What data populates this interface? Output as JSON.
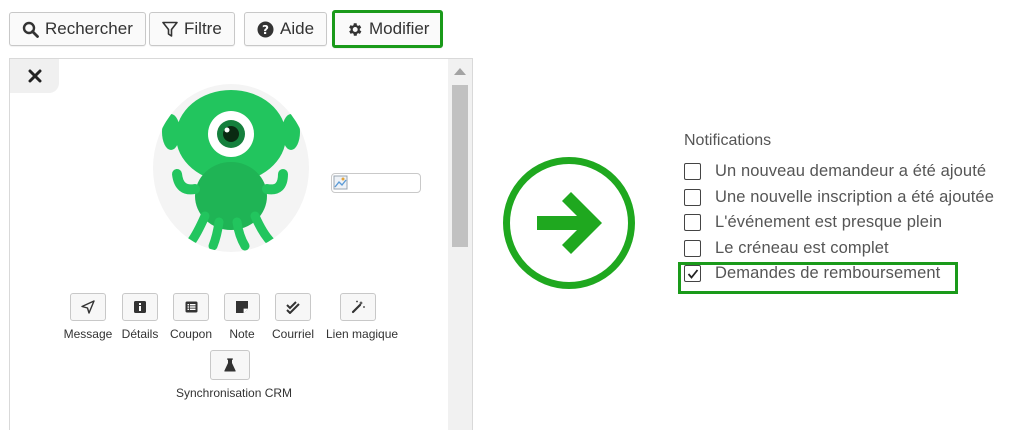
{
  "toolbar": {
    "search_label": "Rechercher",
    "filter_label": "Filtre",
    "help_label": "Aide",
    "edit_label": "Modifier"
  },
  "actions": [
    {
      "label": "Message",
      "icon": "send-icon"
    },
    {
      "label": "Détails",
      "icon": "info-icon"
    },
    {
      "label": "Coupon",
      "icon": "list-icon"
    },
    {
      "label": "Note",
      "icon": "note-icon"
    },
    {
      "label": "Courriel",
      "icon": "double-check-icon"
    },
    {
      "label": "Lien magique",
      "icon": "magic-wand-icon"
    },
    {
      "label": "Synchronisation CRM",
      "icon": "flask-icon"
    }
  ],
  "notifications": {
    "title": "Notifications",
    "items": [
      {
        "label": "Un nouveau demandeur a été ajouté",
        "checked": false
      },
      {
        "label": "Une nouvelle inscription a été ajoutée",
        "checked": false
      },
      {
        "label": "L'événement est presque plein",
        "checked": false
      },
      {
        "label": "Le créneau est complet",
        "checked": false
      },
      {
        "label": "Demandes de remboursement",
        "checked": true
      }
    ]
  },
  "colors": {
    "highlight": "#1a9a1a",
    "arrow": "#1fa81f",
    "avatar_green": "#22c55e"
  }
}
